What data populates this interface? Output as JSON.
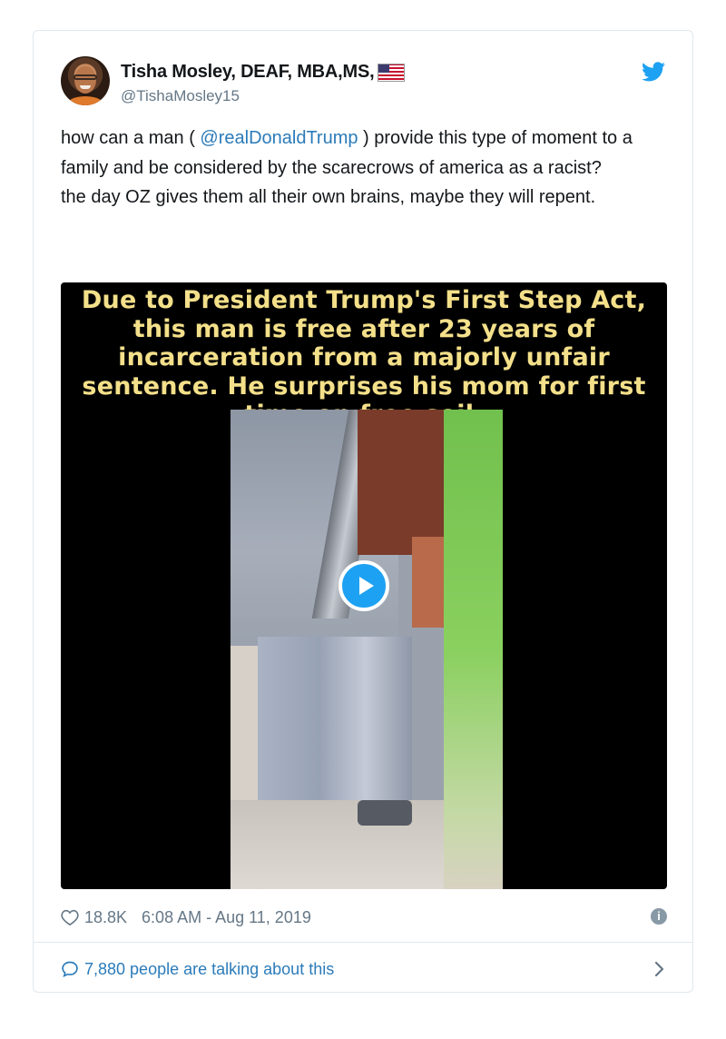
{
  "tweet": {
    "author_name": "Tisha Mosley, DEAF, MBA,MS,",
    "handle": "@TishaMosley15",
    "text_before_mention": "how can a man ( ",
    "mention": "@realDonaldTrump",
    "text_after_mention": " ) provide this type of moment to a family and be considered by the scarecrows of america as a racist?",
    "text_line2": "the day OZ gives them all their own brains, maybe they will repent.",
    "media_caption": "Due to President Trump's First Step Act, this man is free after 23 years of incarceration from a majorly unfair sentence. He surprises his mom for first time on free soil.",
    "likes": "18.8K",
    "timestamp": "6:08 AM - Aug 11, 2019",
    "talking": "7,880 people are talking about this"
  },
  "icons": {
    "flag": "us-flag-icon",
    "brand": "twitter-bird-icon",
    "play": "play-icon",
    "like": "heart-icon",
    "info": "info-icon",
    "comment": "speech-bubble-icon",
    "chevron": "chevron-right-icon"
  },
  "colors": {
    "link": "#2b7bb9",
    "brand": "#1da1f2",
    "caption": "#f4e08a",
    "muted": "#657786"
  }
}
